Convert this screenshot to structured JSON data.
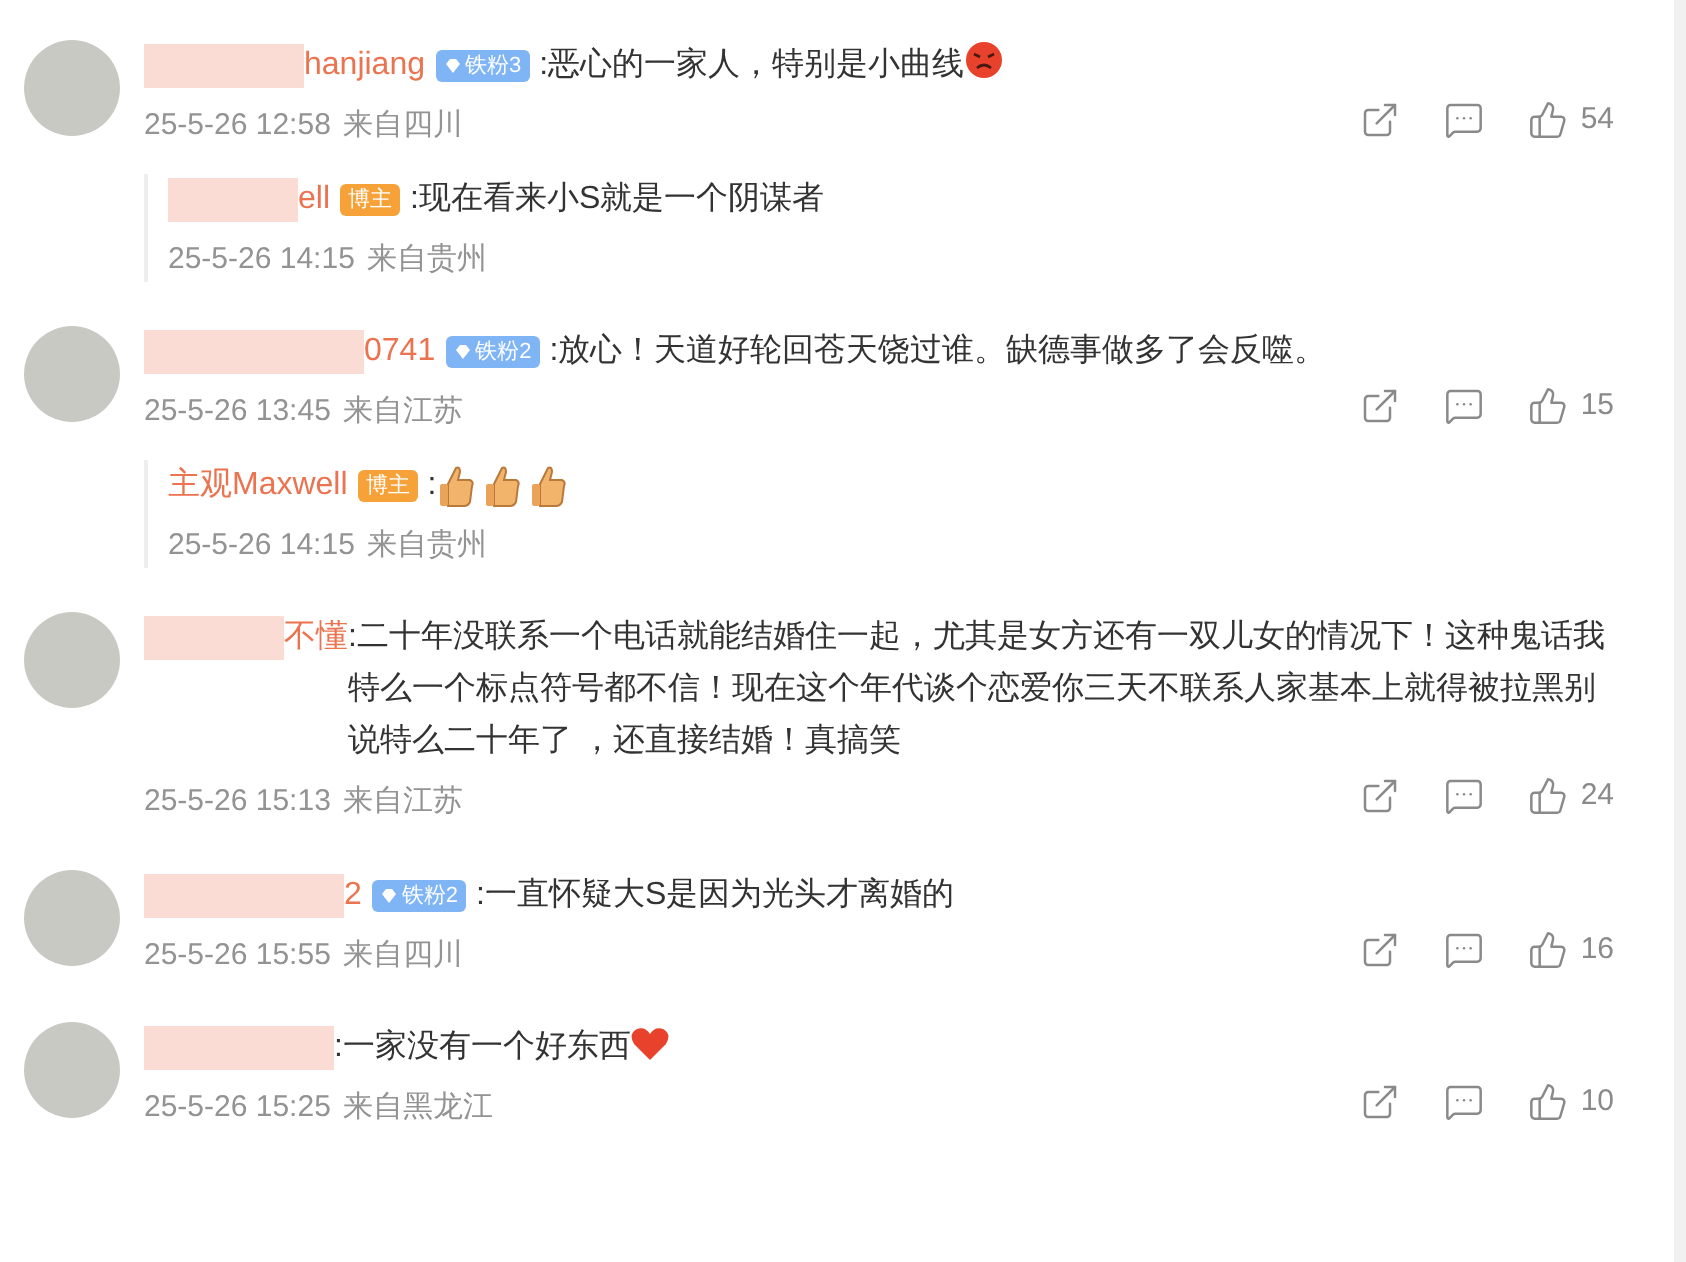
{
  "comments": [
    {
      "name_visible": "hanjiang",
      "badge": {
        "kind": "fan",
        "label": "铁粉3"
      },
      "text": ":恶心的一家人，特别是小曲线",
      "emojis": [
        {
          "kind": "angry"
        }
      ],
      "time": "25-5-26 12:58",
      "location": "来自四川",
      "likes": "54",
      "replies": [
        {
          "name_visible": "ell",
          "badge": {
            "kind": "author",
            "label": "博主"
          },
          "text": ":现在看来小S就是一个阴谋者",
          "time": "25-5-26 14:15",
          "location": "来自贵州"
        }
      ]
    },
    {
      "name_visible": "0741",
      "badge": {
        "kind": "fan",
        "label": "铁粉2"
      },
      "text": ":放心！天道好轮回苍天饶过谁。缺德事做多了会反噬。",
      "time": "25-5-26 13:45",
      "location": "来自江苏",
      "likes": "15",
      "replies": [
        {
          "name_visible": "主观Maxwell",
          "badge": {
            "kind": "author",
            "label": "博主"
          },
          "text": ":",
          "emojis": [
            {
              "kind": "thumbs-up"
            },
            {
              "kind": "thumbs-up"
            },
            {
              "kind": "thumbs-up"
            }
          ],
          "time": "25-5-26 14:15",
          "location": "来自贵州"
        }
      ]
    },
    {
      "name_visible": "不懂",
      "text": ":二十年没联系一个电话就能结婚住一起，尤其是女方还有一双儿女的情况下！这种鬼话我特么一个标点符号都不信！现在这个年代谈个恋爱你三天不联系人家基本上就得被拉黑别说特么二十年了 ，还直接结婚！真搞笑",
      "time": "25-5-26 15:13",
      "location": "来自江苏",
      "likes": "24"
    },
    {
      "name_visible": "2",
      "badge": {
        "kind": "fan",
        "label": "铁粉2"
      },
      "text": ":一直怀疑大S是因为光头才离婚的",
      "time": "25-5-26 15:55",
      "location": "来自四川",
      "likes": "16"
    },
    {
      "text": ":一家没有一个好东西",
      "emojis": [
        {
          "kind": "heart"
        }
      ],
      "time": "25-5-26 15:25",
      "location": "来自黑龙江",
      "likes": "10"
    }
  ]
}
